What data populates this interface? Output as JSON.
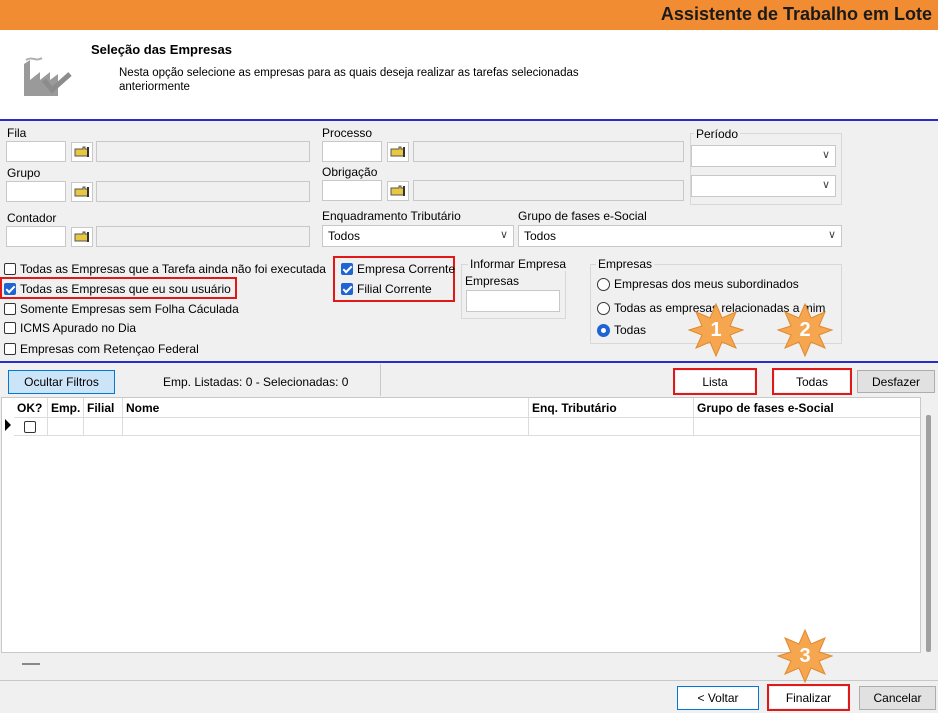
{
  "window": {
    "title": "Assistente de Trabalho em Lote"
  },
  "header": {
    "title": "Seleção das Empresas",
    "description": "Nesta opção selecione as empresas para as quais deseja realizar as tarefas selecionadas anteriormente",
    "icon": "factory-check-icon"
  },
  "filters": {
    "fila_label": "Fila",
    "grupo_label": "Grupo",
    "contador_label": "Contador",
    "processo_label": "Processo",
    "obrigacao_label": "Obrigação",
    "periodo_label": "Período",
    "enquadramento_label": "Enquadramento Tributário",
    "enquadramento_value": "Todos",
    "grupo_fases_label": "Grupo de fases e-Social",
    "grupo_fases_value": "Todos",
    "informar_label": "Informar Empresa",
    "empresas_field_label": "Empresas"
  },
  "checkboxes": [
    {
      "label": "Todas as Empresas que a Tarefa ainda não foi executada",
      "checked": false
    },
    {
      "label": "Todas as Empresas que eu sou usuário",
      "checked": true
    },
    {
      "label": "Somente Empresas sem Folha Cáculada",
      "checked": false
    },
    {
      "label": "ICMS Apurado no Dia",
      "checked": false
    },
    {
      "label": "Empresas com Retençao Federal",
      "checked": false
    }
  ],
  "corrente": [
    {
      "label": "Empresa Corrente",
      "checked": true
    },
    {
      "label": "Filial Corrente",
      "checked": true
    }
  ],
  "empresas_group": {
    "title": "Empresas",
    "options": [
      {
        "label": "Empresas dos meus subordinados",
        "selected": false
      },
      {
        "label": "Todas as empresas relacionadas a mim",
        "selected": false
      },
      {
        "label": "Todas",
        "selected": true
      }
    ]
  },
  "toolbar": {
    "ocultar_label": "Ocultar Filtros",
    "status": "Emp. Listadas: 0 - Selecionadas: 0",
    "lista_label": "Lista",
    "todas_label": "Todas",
    "desfazer_label": "Desfazer"
  },
  "grid": {
    "columns": [
      "OK?",
      "Emp.",
      "Filial",
      "Nome",
      "Enq. Tributário",
      "Grupo de fases e-Social"
    ]
  },
  "footer": {
    "voltar_label": "< Voltar",
    "finalizar_label": "Finalizar",
    "cancelar_label": "Cancelar"
  },
  "annotations": {
    "star1": "1",
    "star2": "2",
    "star3": "3",
    "color": "#f5a64e"
  },
  "colors": {
    "titlebar": "#f28c33",
    "highlight": "#e01818",
    "accent": "#1e64d2"
  }
}
